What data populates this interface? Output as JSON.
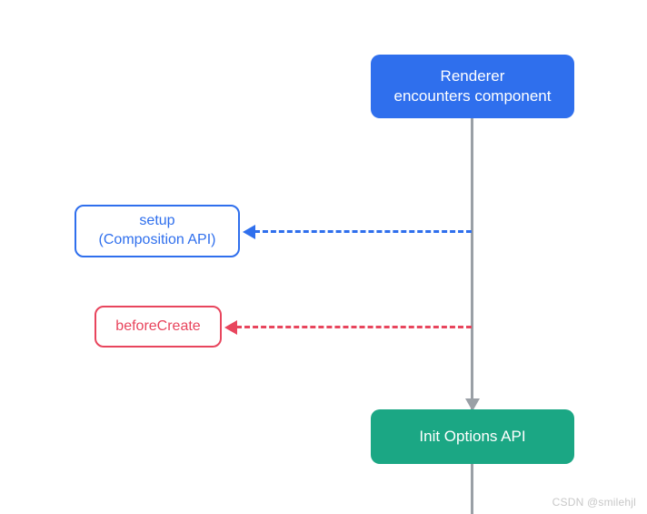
{
  "chart_data": {
    "type": "flow-diagram",
    "title": "",
    "nodes": [
      {
        "id": "renderer",
        "label": "Renderer\nencounters component",
        "style": "filled-blue"
      },
      {
        "id": "setup",
        "label": "setup\n(Composition API)",
        "style": "outlined-blue"
      },
      {
        "id": "beforeCreate",
        "label": "beforeCreate",
        "style": "outlined-red"
      },
      {
        "id": "initOptions",
        "label": "Init Options API",
        "style": "filled-green"
      }
    ],
    "edges": [
      {
        "from": "renderer",
        "to": "initOptions",
        "style": "solid-gray",
        "direction": "down"
      },
      {
        "from": "renderer-initOptions-line",
        "to": "setup",
        "style": "dashed-blue",
        "direction": "left"
      },
      {
        "from": "renderer-initOptions-line",
        "to": "beforeCreate",
        "style": "dashed-red",
        "direction": "left"
      },
      {
        "from": "initOptions",
        "to": "below",
        "style": "solid-gray",
        "direction": "down"
      }
    ],
    "colors": {
      "blue": "#2F6FED",
      "red": "#E8455D",
      "green": "#1BA784",
      "gray": "#9AA0A6"
    }
  },
  "nodes": {
    "renderer": {
      "line1": "Renderer",
      "line2": "encounters component"
    },
    "setup": {
      "line1": "setup",
      "line2": "(Composition API)"
    },
    "beforeCreate": {
      "label": "beforeCreate"
    },
    "initOptions": {
      "label": "Init Options API"
    }
  },
  "watermark": "CSDN @smilehjl"
}
